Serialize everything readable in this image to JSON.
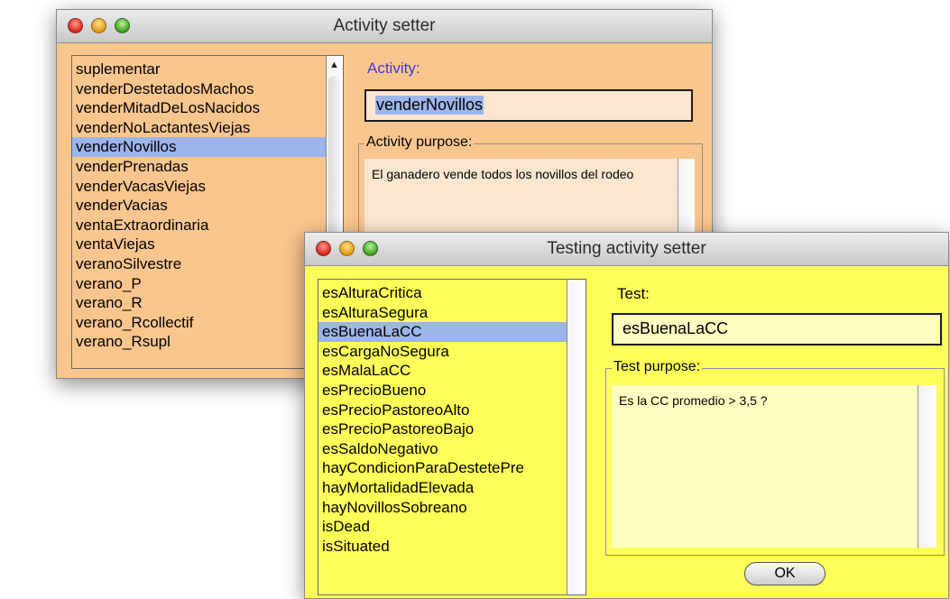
{
  "activity_window": {
    "title": "Activity setter",
    "list_items": [
      "suplementar",
      "venderDestetadosMachos",
      "venderMitadDeLosNacidos",
      "venderNoLactantesViejas",
      "venderNovillos",
      "venderPrenadas",
      "venderVacasViejas",
      "venderVacias",
      "ventaExtraordinaria",
      "ventaViejas",
      "veranoSilvestre",
      "verano_P",
      "verano_R",
      "verano_Rcollectif",
      "verano_Rsupl"
    ],
    "selected_index": 4,
    "activity_label": "Activity:",
    "activity_value": "venderNovillos",
    "purpose_label": "Activity purpose:",
    "purpose_text": "El ganadero vende todos los novillos del rodeo",
    "scroll_up_glyph": "▲",
    "bg_color": "#fbc68e"
  },
  "testing_window": {
    "title": "Testing activity setter",
    "list_items": [
      "esAlturaCritica",
      "esAlturaSegura",
      "esBuenaLaCC",
      "esCargaNoSegura",
      "esMalaLaCC",
      "esPrecioBueno",
      "esPrecioPastoreoAlto",
      "esPrecioPastoreoBajo",
      "esSaldoNegativo",
      "hayCondicionParaDestetePre",
      "hayMortalidadElevada",
      "hayNovillosSobreano",
      "isDead",
      "isSituated"
    ],
    "selected_index": 2,
    "test_label": "Test:",
    "test_value": "esBuenaLaCC",
    "purpose_label": "Test purpose:",
    "purpose_text": "Es la CC promedio > 3,5 ?",
    "ok_label": "OK",
    "bg_color": "#ffff5a"
  }
}
